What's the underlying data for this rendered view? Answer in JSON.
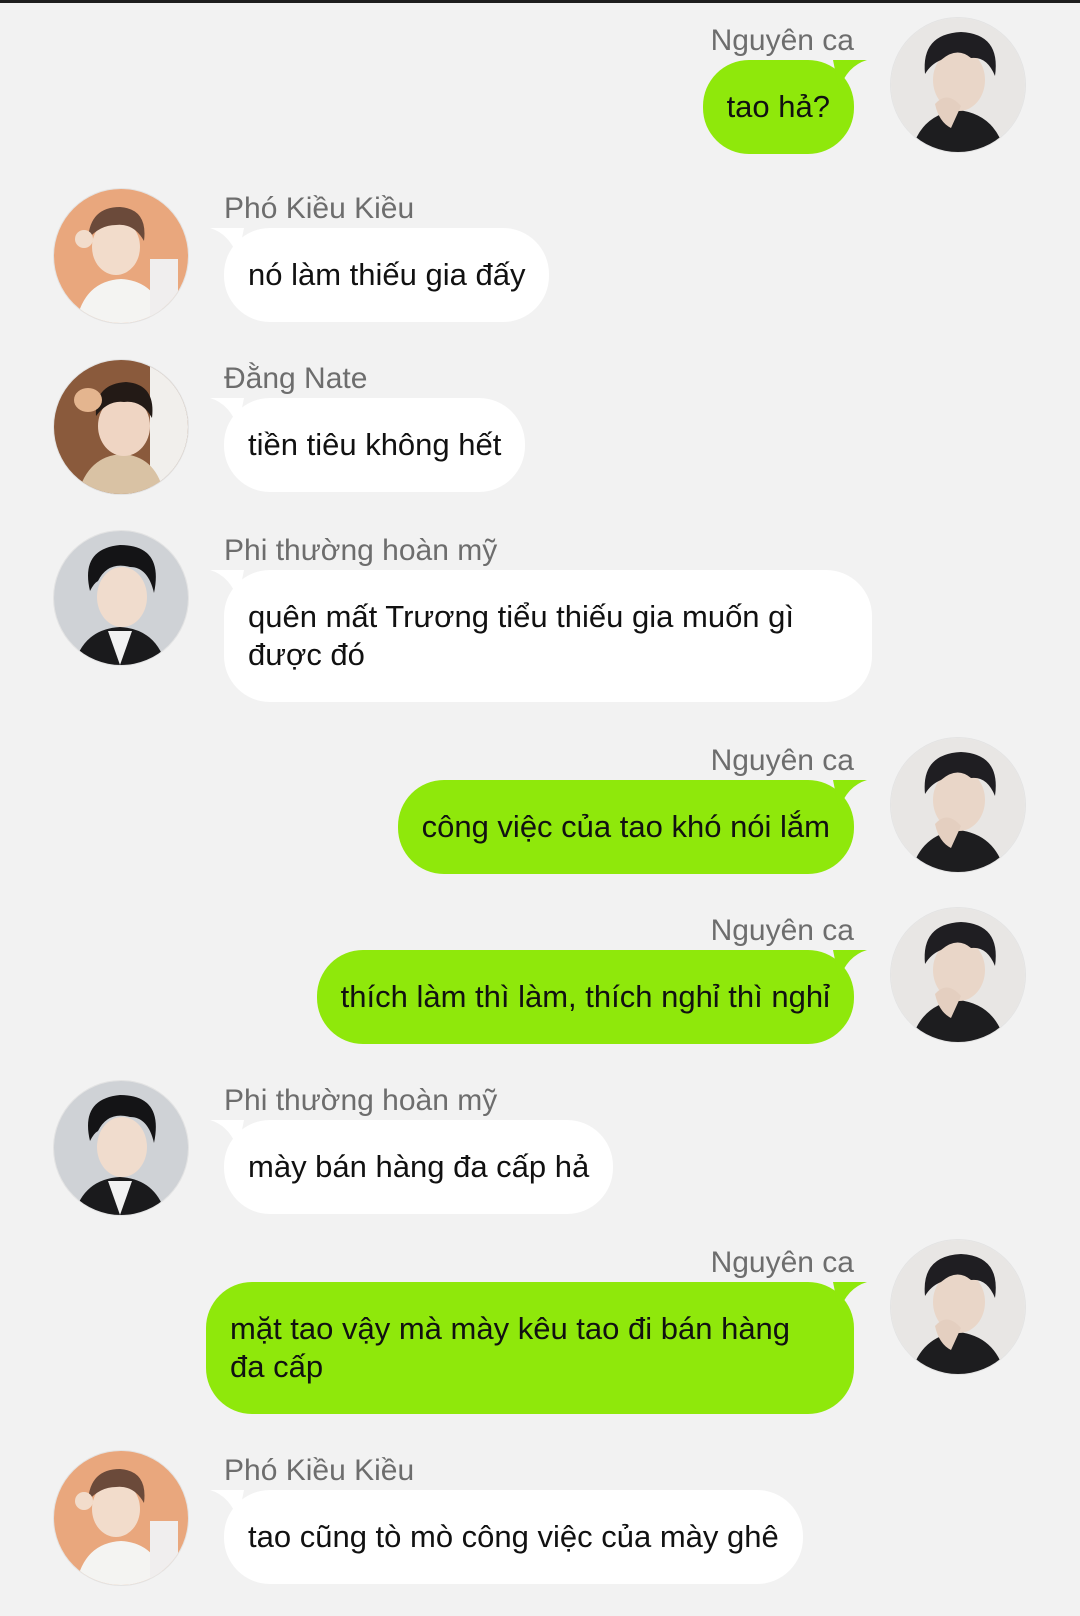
{
  "colors": {
    "background": "#f2f2f2",
    "own_bubble": "#8fe80b",
    "other_bubble": "#ffffff",
    "name_text": "#6d6d6d",
    "message_text": "#111111"
  },
  "messages": [
    {
      "sender": "Nguyên ca",
      "text": "tao hả?",
      "own": true,
      "avatar": "avatar-nguyen-ca"
    },
    {
      "sender": "Phó Kiều Kiều",
      "text": "nó làm thiếu gia đấy",
      "own": false,
      "avatar": "avatar-pho-kieu-kieu"
    },
    {
      "sender": "Đằng Nate",
      "text": "tiền tiêu không hết",
      "own": false,
      "avatar": "avatar-dang-nate"
    },
    {
      "sender": "Phi thường hoàn mỹ",
      "text": "quên mất Trương tiểu thiếu gia muốn gì được đó",
      "own": false,
      "avatar": "avatar-phi-thuong-hoan-my"
    },
    {
      "sender": "Nguyên ca",
      "text": "công việc của tao khó nói lắm",
      "own": true,
      "avatar": "avatar-nguyen-ca"
    },
    {
      "sender": "Nguyên ca",
      "text": "thích làm thì làm, thích nghỉ thì nghỉ",
      "own": true,
      "avatar": "avatar-nguyen-ca"
    },
    {
      "sender": "Phi thường hoàn mỹ",
      "text": "mày bán hàng đa cấp hả",
      "own": false,
      "avatar": "avatar-phi-thuong-hoan-my"
    },
    {
      "sender": "Nguyên ca",
      "text": "mặt tao vậy mà mày kêu tao đi bán hàng đa cấp",
      "own": true,
      "avatar": "avatar-nguyen-ca"
    },
    {
      "sender": "Phó Kiều Kiều",
      "text": "tao cũng tò mò công việc của mày ghê",
      "own": false,
      "avatar": "avatar-pho-kieu-kieu"
    }
  ]
}
